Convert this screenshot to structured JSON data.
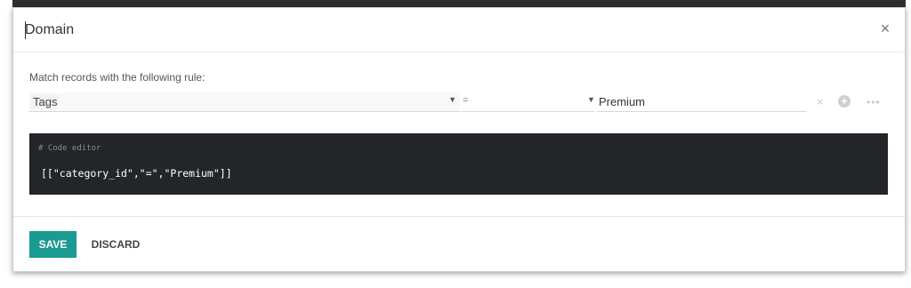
{
  "modal": {
    "title": "Domain",
    "close_icon": "close-icon"
  },
  "body": {
    "rule_label": "Match records with the following rule:",
    "rule": {
      "path": "Tags",
      "operator": "=",
      "value": "Premium"
    },
    "code_editor": {
      "comment": "# Code editor",
      "code": "[[\"category_id\",\"=\",\"Premium\"]]"
    }
  },
  "footer": {
    "save_label": "SAVE",
    "discard_label": "DISCARD"
  },
  "colors": {
    "primary": "#1a9a92",
    "code_bg": "#232528"
  }
}
